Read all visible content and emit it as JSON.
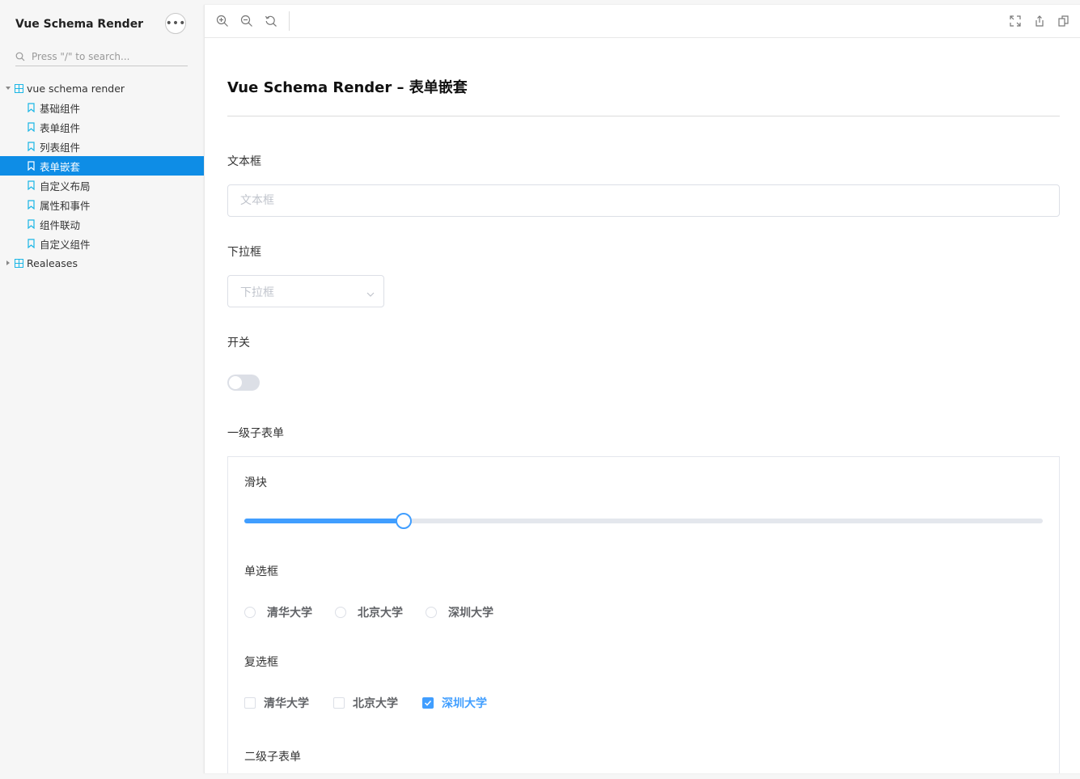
{
  "sidebar": {
    "brand": "Vue Schema Render",
    "search_placeholder": "Press \"/\" to search...",
    "tree": {
      "root_label": "vue schema render",
      "items": [
        {
          "label": "基础组件"
        },
        {
          "label": "表单组件"
        },
        {
          "label": "列表组件"
        },
        {
          "label": "表单嵌套",
          "active": true
        },
        {
          "label": "自定义布局"
        },
        {
          "label": "属性和事件"
        },
        {
          "label": "组件联动"
        },
        {
          "label": "自定义组件"
        }
      ],
      "releases_label": "Realeases"
    }
  },
  "toolbar": {
    "left_icons": [
      "zoom-in-icon",
      "zoom-out-icon",
      "zoom-reset-icon"
    ],
    "right_icons": [
      "fullscreen-icon",
      "share-icon",
      "copy-icon"
    ]
  },
  "page": {
    "title": "Vue Schema Render – 表单嵌套",
    "text_label": "文本框",
    "text_placeholder": "文本框",
    "select_label": "下拉框",
    "select_placeholder": "下拉框",
    "switch_label": "开关",
    "switch_on": false,
    "subform_label": "一级子表单",
    "subform": {
      "slider_label": "滑块",
      "slider_value": 0.2,
      "radio_label": "单选框",
      "radio_options": [
        "清华大学",
        "北京大学",
        "深圳大学"
      ],
      "checkbox_label": "复选框",
      "checkbox_options": [
        "清华大学",
        "北京大学",
        "深圳大学"
      ],
      "checkbox_checked": "深圳大学",
      "nested_label": "二级子表单"
    }
  },
  "colors": {
    "accent": "#409eff",
    "sidebar_active": "#0e8de6",
    "tree_icon": "#1ab6e6"
  }
}
